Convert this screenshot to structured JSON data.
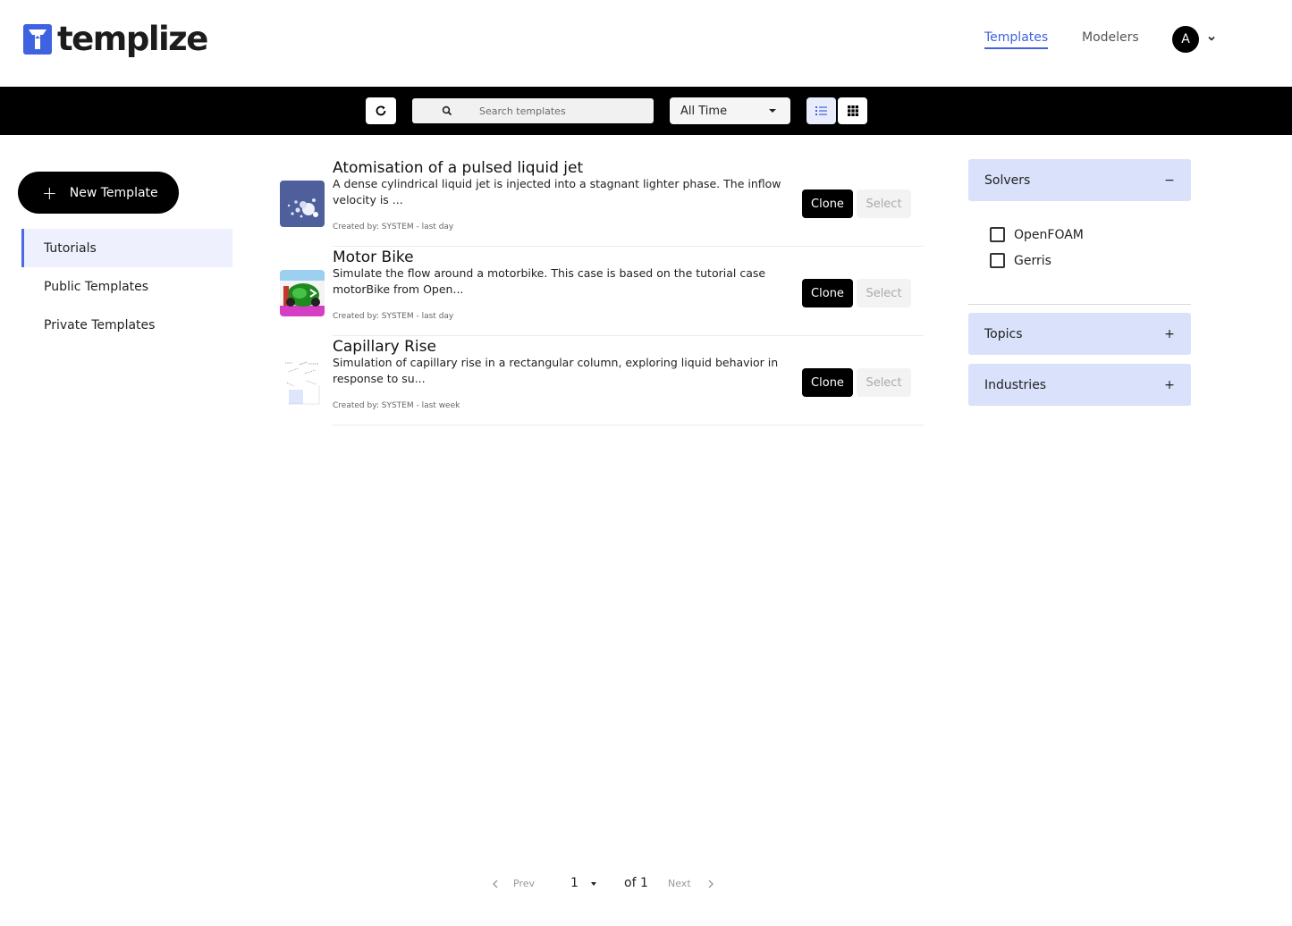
{
  "header": {
    "logo_text": "templize",
    "nav": {
      "templates": "Templates",
      "modelers": "Modelers"
    },
    "avatar_initial": "A"
  },
  "toolbar": {
    "search_placeholder": "Search templates",
    "time_filter": "All Time"
  },
  "sidebar": {
    "new_template_label": "New Template",
    "items": [
      {
        "label": "Tutorials",
        "active": true
      },
      {
        "label": "Public Templates",
        "active": false
      },
      {
        "label": "Private Templates",
        "active": false
      }
    ]
  },
  "templates": [
    {
      "title": "Atomisation of a pulsed liquid jet",
      "description": "A dense cylindrical liquid jet is injected into a stagnant lighter phase. The inflow velocity is ...",
      "meta": "Created by: SYSTEM - last day",
      "clone_label": "Clone",
      "select_label": "Select"
    },
    {
      "title": "Motor Bike",
      "description": "Simulate the flow around a motorbike. This case is based on the tutorial case motorBike from Open...",
      "meta": "Created by: SYSTEM - last day",
      "clone_label": "Clone",
      "select_label": "Select"
    },
    {
      "title": "Capillary Rise",
      "description": "Simulation of capillary rise in a rectangular column, exploring liquid behavior in response to su...",
      "meta": "Created by: SYSTEM - last week",
      "clone_label": "Clone",
      "select_label": "Select"
    }
  ],
  "filters": {
    "solvers": {
      "title": "Solvers",
      "toggle": "−",
      "options": [
        "OpenFOAM",
        "Gerris"
      ]
    },
    "topics": {
      "title": "Topics",
      "toggle": "+"
    },
    "industries": {
      "title": "Industries",
      "toggle": "+"
    }
  },
  "pagination": {
    "prev": "Prev",
    "page": "1",
    "of": "of 1",
    "next": "Next"
  },
  "colors": {
    "accent": "#3f63e0",
    "toolbar_bg": "#000000",
    "filter_header_bg": "#d9e1fb",
    "active_nav_bg": "#eef1fd"
  }
}
